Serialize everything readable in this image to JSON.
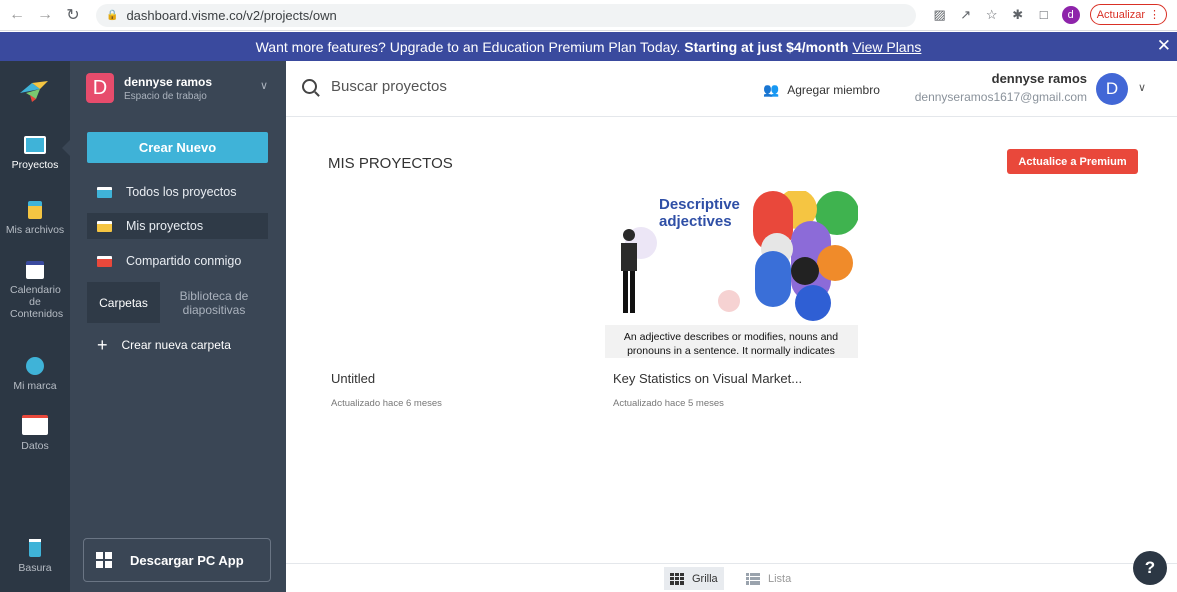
{
  "browser": {
    "url": "dashboard.visme.co/v2/projects/own",
    "profile_initial": "d",
    "update_label": "Actualizar"
  },
  "banner": {
    "text": "Want more features? Upgrade to an Education Premium Plan Today.",
    "bold": "Starting at just $4/month",
    "link": "View Plans"
  },
  "rail": {
    "items": [
      {
        "label": "Proyectos"
      },
      {
        "label": "Mis archivos"
      },
      {
        "label": "Calendario de Contenidos"
      },
      {
        "label": "Mi marca"
      },
      {
        "label": "Datos"
      },
      {
        "label": "Basura"
      }
    ]
  },
  "workspace": {
    "initial": "D",
    "name": "dennyse ramos",
    "subtitle": "Espacio de trabajo"
  },
  "panel": {
    "create_label": "Crear Nuevo",
    "items": [
      {
        "label": "Todos los proyectos"
      },
      {
        "label": "Mis proyectos"
      },
      {
        "label": "Compartido conmigo"
      }
    ],
    "tab_folders": "Carpetas",
    "tab_library": "Biblioteca de diapositivas",
    "new_folder": "Crear nueva carpeta",
    "download_app": "Descargar PC App"
  },
  "topbar": {
    "search_placeholder": "Buscar proyectos",
    "add_member": "Agregar miembro",
    "user_name": "dennyse ramos",
    "user_email": "dennyseramos1617@gmail.com",
    "user_initial": "D"
  },
  "main": {
    "title": "MIS PROYECTOS",
    "premium_button": "Actualice a Premium",
    "projects": [
      {
        "title": "Untitled",
        "updated": "Actualizado hace 6 meses"
      },
      {
        "title": "Key Statistics on Visual Market...",
        "updated": "Actualizado hace 5 meses",
        "thumb_title_1": "Descriptive",
        "thumb_title_2": "adjectives",
        "thumb_caption_1": "An adjective describes or modifies, nouns and",
        "thumb_caption_2": "pronouns in a sentence. It normally indicates"
      }
    ]
  },
  "view": {
    "grid": "Grilla",
    "list": "Lista"
  },
  "help": {
    "label": "?"
  }
}
